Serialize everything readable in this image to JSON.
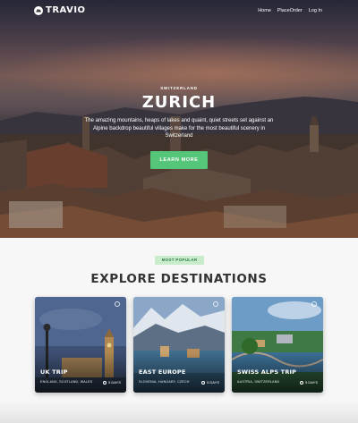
{
  "nav": {
    "logo": "TRAVIO",
    "links": [
      "Home",
      "PlaceOrder",
      "Log In"
    ]
  },
  "hero": {
    "subtitle": "SWITZERLAND",
    "title": "ZURICH",
    "description": "The amazing mountains, heaps of lakes and quaint, quiet streets set against an Alpine backdrop beautiful villages make for the most beautiful scenery in Switzerland",
    "button": "LEARN MORE"
  },
  "section": {
    "badge": "MOST POPULAR",
    "title": "EXPLORE DESTINATIONS"
  },
  "cards": [
    {
      "title": "UK TRIP",
      "location": "ENGLAND, SCOTLAND, WALES",
      "days": "5 DAYS"
    },
    {
      "title": "EAST EUROPE",
      "location": "SLOVENIA, HUNGARY, CZECH",
      "days": "5 DAYS"
    },
    {
      "title": "SWISS ALPS TRIP",
      "location": "AUSTRIA, SWITZERLAND",
      "days": "5 DAYS"
    }
  ],
  "colors": {
    "accent": "#55c57a",
    "badge_bg": "#c9eccd",
    "heading": "#333333"
  }
}
